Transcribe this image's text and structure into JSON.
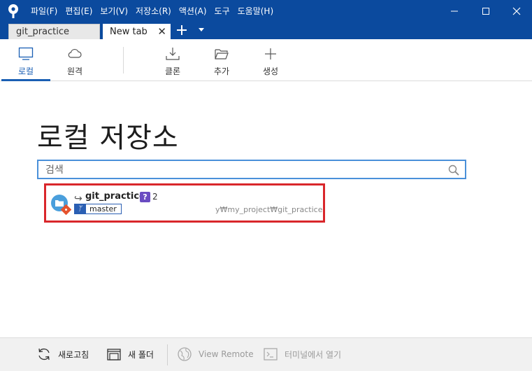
{
  "menubar": {
    "items": [
      "파일(F)",
      "편집(E)",
      "보기(V)",
      "저장소(R)",
      "액션(A)",
      "도구",
      "도움말(H)"
    ]
  },
  "tabs": {
    "items": [
      {
        "label": "git_practice",
        "active": false
      },
      {
        "label": "New tab",
        "active": true
      }
    ]
  },
  "toolbar": {
    "local": "로컬",
    "remote": "원격",
    "clone": "클론",
    "add": "추가",
    "create": "생성"
  },
  "main": {
    "title": "로컬 저장소",
    "search_placeholder": "검색"
  },
  "repo": {
    "name": "git_practice",
    "badge": "?",
    "count": "2",
    "branch": "master",
    "path": "y₩my_project₩git_practice"
  },
  "footer": {
    "refresh": "새로고침",
    "new_folder": "새 폴더",
    "view_remote": "View Remote",
    "open_terminal": "터미널에서 열기"
  },
  "colors": {
    "titlebar": "#0b4a9e",
    "accent": "#1a5fb4",
    "highlight_border": "#d9262b",
    "badge": "#6a4cc2"
  }
}
